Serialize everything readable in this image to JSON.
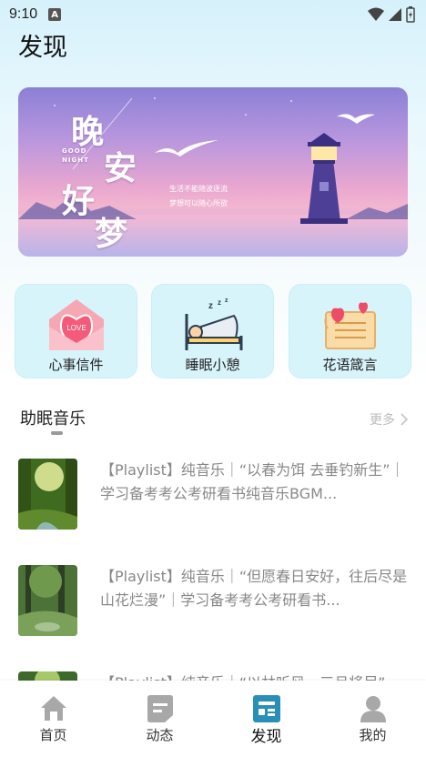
{
  "status_bar": {
    "time": "9:10",
    "notif_letter": "A"
  },
  "page": {
    "title": "发现"
  },
  "banner": {
    "title_chars": [
      "晚",
      "安",
      "好",
      "梦"
    ],
    "good_night": [
      "GOOD",
      "NIGHT"
    ],
    "subtitle_lines": [
      "生活不能随波逐流",
      "梦想可以随心所欲"
    ]
  },
  "quick_entries": [
    {
      "label": "心事信件",
      "icon": "love-letter-icon",
      "badge": "LOVE"
    },
    {
      "label": "睡眠小憩",
      "icon": "sleep-bed-icon"
    },
    {
      "label": "花语箴言",
      "icon": "scroll-hearts-icon"
    }
  ],
  "section": {
    "title": "助眠音乐",
    "more": "更多"
  },
  "music_list": [
    {
      "text": "【Playlist】纯音乐｜“以春为饵 去垂钓新生”｜学习备考考公考研看书纯音乐BGM..."
    },
    {
      "text": "【Playlist】纯音乐｜“但愿春日安好，往后尽是山花烂漫”｜学习备考考公考研看书..."
    },
    {
      "text": "【Playlist】纯音乐｜“以林听风，三月将尽”"
    }
  ],
  "bottom_nav": [
    {
      "label": "首页",
      "icon": "home-icon"
    },
    {
      "label": "动态",
      "icon": "feed-icon"
    },
    {
      "label": "发现",
      "icon": "discover-icon",
      "active": true
    },
    {
      "label": "我的",
      "icon": "profile-icon"
    }
  ],
  "colors": {
    "accent": "#2a8fb8",
    "nav_inactive": "#a8a8a8",
    "card_bg": "#d8f4fb"
  }
}
